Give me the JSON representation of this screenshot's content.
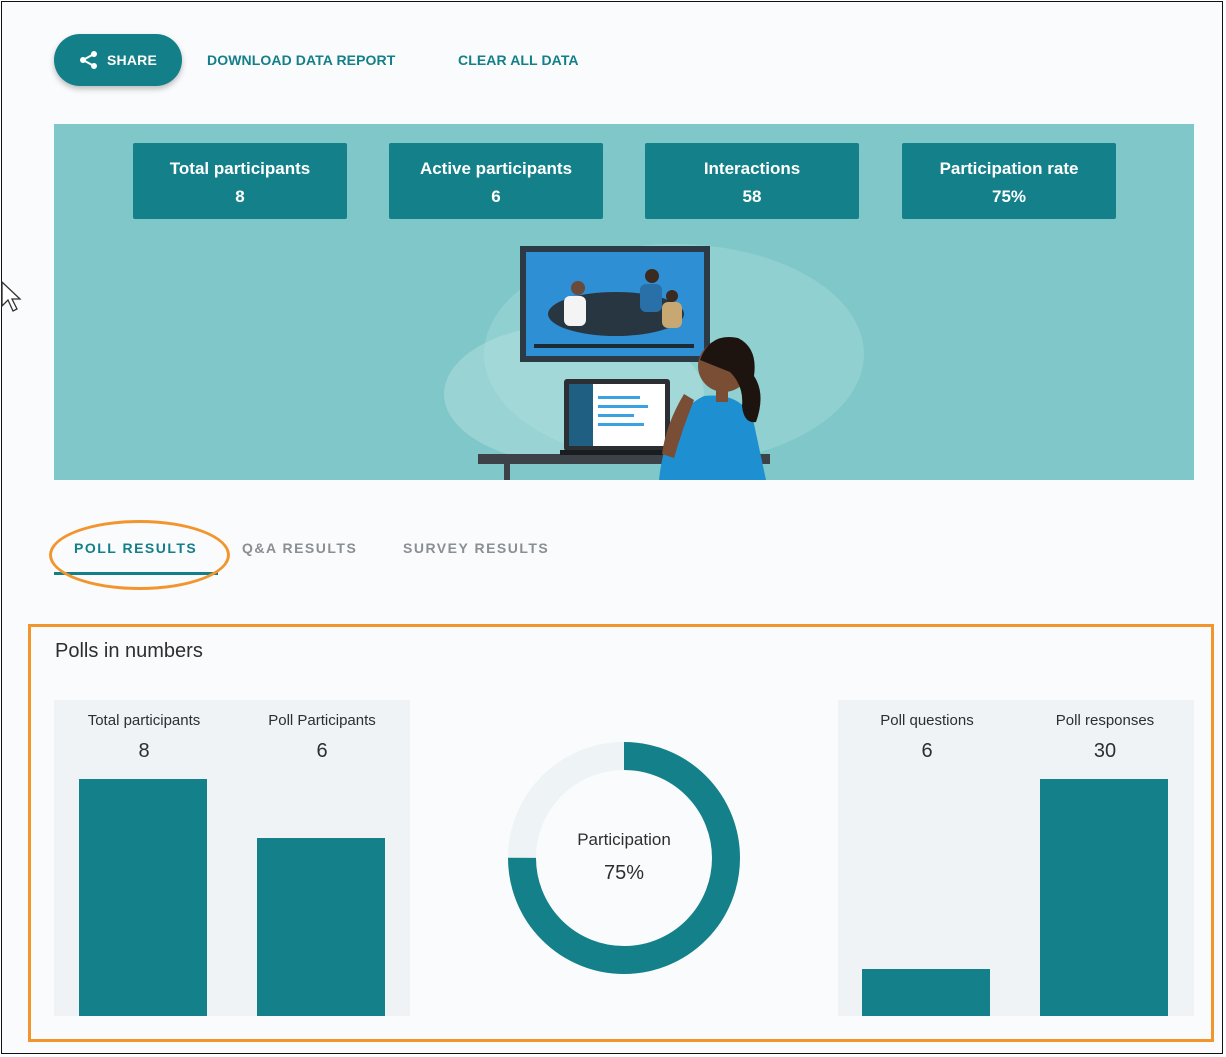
{
  "toolbar": {
    "share_label": "SHARE",
    "download_label": "DOWNLOAD DATA REPORT",
    "clear_label": "CLEAR ALL DATA"
  },
  "summary": [
    {
      "label": "Total participants",
      "value": "8"
    },
    {
      "label": "Active participants",
      "value": "6"
    },
    {
      "label": "Interactions",
      "value": "58"
    },
    {
      "label": "Participation rate",
      "value": "75%"
    }
  ],
  "tabs": [
    {
      "label": "POLL RESULTS",
      "active": true
    },
    {
      "label": "Q&A RESULTS",
      "active": false
    },
    {
      "label": "SURVEY RESULTS",
      "active": false
    }
  ],
  "polls": {
    "title": "Polls in numbers",
    "participation_label": "Participation",
    "participation_value": "75%",
    "participation_fraction": 0.75
  },
  "chart_data": {
    "type": "bar",
    "groups": [
      {
        "categories": [
          "Total participants",
          "Poll Participants"
        ],
        "values": [
          8,
          6
        ],
        "labels": [
          "8",
          "6"
        ]
      },
      {
        "categories": [
          "Poll questions",
          "Poll responses"
        ],
        "values": [
          6,
          30
        ],
        "labels": [
          "6",
          "30"
        ]
      }
    ]
  },
  "colors": {
    "accent": "#137f88",
    "bar": "#14808a",
    "hero_bg": "#7fc7c9",
    "annotation": "#f3952d",
    "panel": "#eff3f6"
  },
  "icons": {
    "share": "share-icon",
    "cursor": "mouse-cursor-icon"
  }
}
